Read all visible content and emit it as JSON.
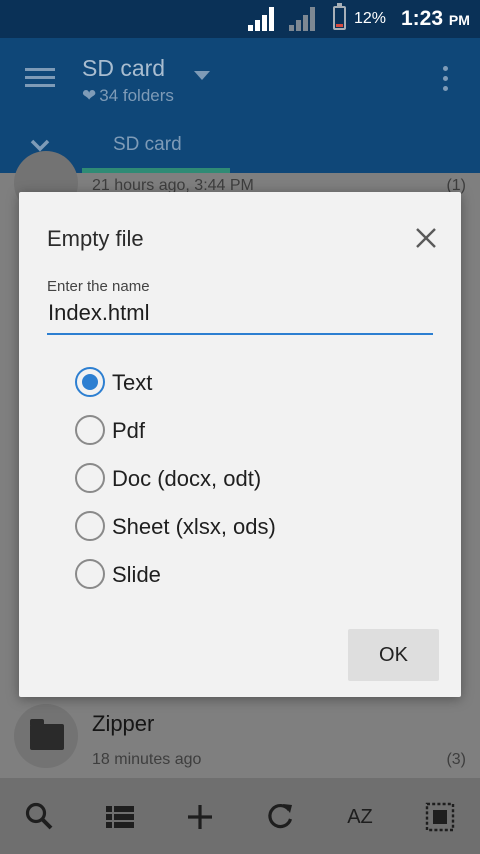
{
  "status_bar": {
    "battery_percent": "12%",
    "time": "1:23",
    "ampm": "PM"
  },
  "app_bar": {
    "title": "SD card",
    "subtitle": "34 folders",
    "tab": "SD card",
    "icons": [
      "menu-icon",
      "heart-icon",
      "dropdown-arrow-icon",
      "more-vert-icon",
      "chevron-down-icon"
    ]
  },
  "file_list": [
    {
      "name": "",
      "date": "21 hours ago, 3:44 PM",
      "count": "(1)"
    },
    {
      "name": "Zipper",
      "date": "18 minutes ago",
      "count": "(3)"
    }
  ],
  "dialog": {
    "title": "Empty file",
    "field_label": "Enter the name",
    "field_value": "Index.html",
    "options": [
      {
        "label": "Text",
        "checked": true
      },
      {
        "label": "Pdf",
        "checked": false
      },
      {
        "label": "Doc (docx, odt)",
        "checked": false
      },
      {
        "label": "Sheet (xlsx, ods)",
        "checked": false
      },
      {
        "label": "Slide",
        "checked": false
      }
    ],
    "ok_label": "OK"
  },
  "toolbar": {
    "sort_label": "AZ",
    "icons": [
      "search-icon",
      "view-list-icon",
      "add-icon",
      "refresh-icon",
      "sort-az-icon",
      "select-all-icon"
    ]
  },
  "colors": {
    "status_bar": "#0a3157",
    "app_bar": "#0f4778",
    "accent": "#2d7fd1",
    "tab_indicator": "#2f8b75",
    "dialog_bg": "#f2f2f2"
  }
}
